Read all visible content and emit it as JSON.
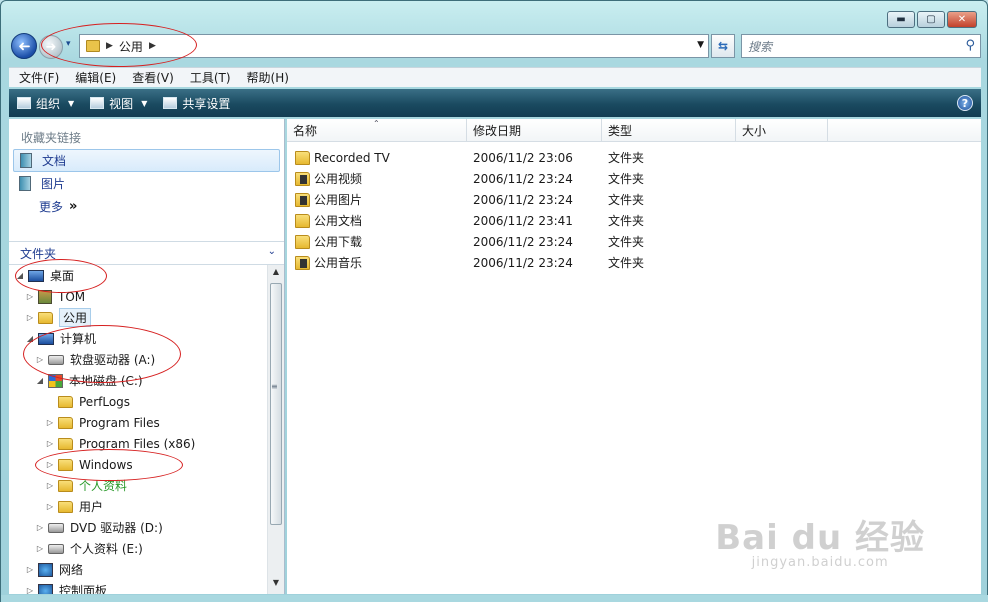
{
  "navigation": {
    "back_glyph": "➜",
    "forward_glyph": "➜",
    "history_glyph": "▾",
    "address_crumb": "公用",
    "breadcrumb_arrow": "▶",
    "address_dropdown": "▼",
    "refresh_glyph": "⇆",
    "search_placeholder": "搜索",
    "search_glyph": "⚲"
  },
  "caption_buttons": {
    "minimize": "▬",
    "maximize": "▢",
    "close": "✕"
  },
  "menu": [
    "文件(F)",
    "编辑(E)",
    "查看(V)",
    "工具(T)",
    "帮助(H)"
  ],
  "toolbar": {
    "organize": "组织",
    "views": "视图",
    "share": "共享设置",
    "caret": "▼",
    "help": "?"
  },
  "favorites": {
    "header": "收藏夹链接",
    "items": [
      {
        "label": "文档",
        "icon": "documents-icon",
        "selected": true
      },
      {
        "label": "图片",
        "icon": "pictures-icon",
        "selected": false
      }
    ],
    "more_label": "更多",
    "more_glyph": "»"
  },
  "folders": {
    "header": "文件夹",
    "chevron": "⌄",
    "tree": [
      {
        "label": "桌面",
        "icon": "desktop-icon",
        "level": 0,
        "expanded": true
      },
      {
        "label": "TOM",
        "icon": "user-folder-icon",
        "level": 1,
        "expanded": false
      },
      {
        "label": "公用",
        "icon": "folder-icon",
        "level": 1,
        "expanded": false,
        "selected": true
      },
      {
        "label": "计算机",
        "icon": "computer-icon",
        "level": 1,
        "expanded": true
      },
      {
        "label": "软盘驱动器 (A:)",
        "icon": "floppy-drive-icon",
        "level": 2,
        "expanded": false
      },
      {
        "label": "本地磁盘 (C:)",
        "icon": "local-disk-icon",
        "level": 2,
        "expanded": true
      },
      {
        "label": "PerfLogs",
        "icon": "folder-icon",
        "level": 3,
        "expanded": null
      },
      {
        "label": "Program Files",
        "icon": "folder-icon",
        "level": 3,
        "expanded": false
      },
      {
        "label": "Program Files (x86)",
        "icon": "folder-icon",
        "level": 3,
        "expanded": false
      },
      {
        "label": "Windows",
        "icon": "folder-icon",
        "level": 3,
        "expanded": false
      },
      {
        "label": "个人资料",
        "icon": "folder-icon",
        "level": 3,
        "expanded": false,
        "green": true
      },
      {
        "label": "用户",
        "icon": "folder-icon",
        "level": 3,
        "expanded": false
      },
      {
        "label": "DVD 驱动器 (D:)",
        "icon": "dvd-drive-icon",
        "level": 2,
        "expanded": false
      },
      {
        "label": "个人资料 (E:)",
        "icon": "drive-icon",
        "level": 2,
        "expanded": false
      },
      {
        "label": "网络",
        "icon": "network-icon",
        "level": 1,
        "expanded": false
      },
      {
        "label": "控制面板",
        "icon": "control-panel-icon",
        "level": 1,
        "expanded": false
      }
    ]
  },
  "scrollbar": {
    "up": "▲",
    "down": "▼",
    "grip": "≡"
  },
  "file_list": {
    "sort_glyph": "⌃",
    "columns": [
      "名称",
      "修改日期",
      "类型",
      "大小"
    ],
    "rows": [
      {
        "name": "Recorded TV",
        "date": "2006/11/2 23:06",
        "type": "文件夹",
        "icon": "folder-icon"
      },
      {
        "name": "公用视频",
        "date": "2006/11/2 23:24",
        "type": "文件夹",
        "icon": "video-folder-icon"
      },
      {
        "name": "公用图片",
        "date": "2006/11/2 23:24",
        "type": "文件夹",
        "icon": "pictures-folder-icon"
      },
      {
        "name": "公用文档",
        "date": "2006/11/2 23:41",
        "type": "文件夹",
        "icon": "documents-folder-icon"
      },
      {
        "name": "公用下载",
        "date": "2006/11/2 23:24",
        "type": "文件夹",
        "icon": "downloads-folder-icon"
      },
      {
        "name": "公用音乐",
        "date": "2006/11/2 23:24",
        "type": "文件夹",
        "icon": "music-folder-icon"
      }
    ]
  },
  "watermark": {
    "brand": "Bai du 经验",
    "url": "jingyan.baidu.com"
  }
}
